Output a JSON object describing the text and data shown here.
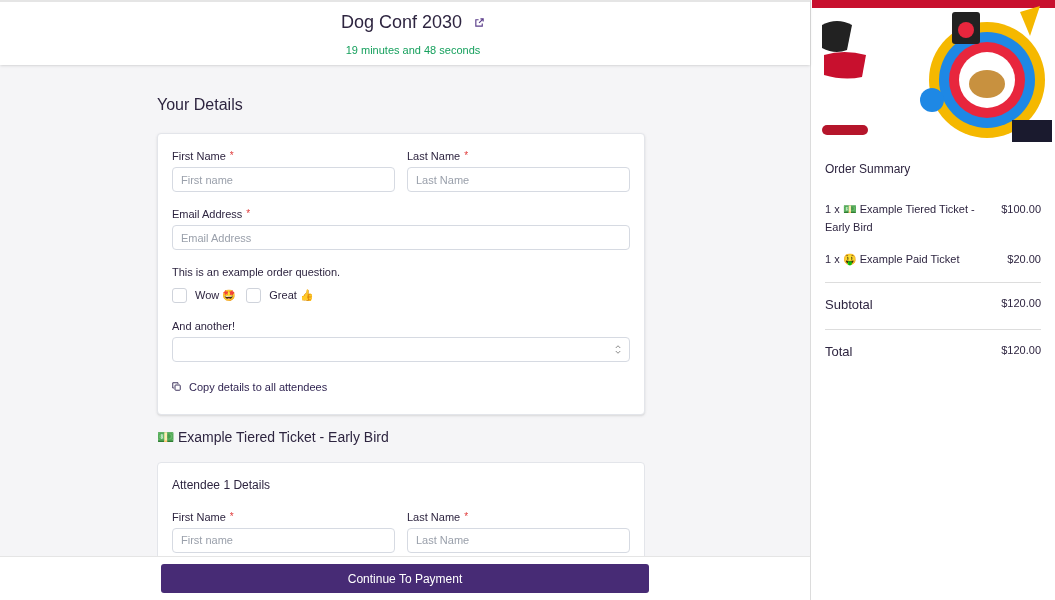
{
  "header": {
    "title": "Dog Conf 2030",
    "timer": "19 minutes and 48 seconds"
  },
  "details": {
    "heading": "Your Details",
    "name_fields": [
      {
        "label": "First Name",
        "required_mark": "*",
        "placeholder": "First name"
      },
      {
        "label": "Last Name",
        "required_mark": "*",
        "placeholder": "Last Name"
      }
    ],
    "email_field": {
      "label": "Email Address",
      "required_mark": "*",
      "placeholder": "Email Address"
    },
    "question": {
      "label": "This is an example order question.",
      "options": [
        {
          "label": "Wow 🤩",
          "checked": false
        },
        {
          "label": "Great 👍",
          "checked": false
        }
      ]
    },
    "select": {
      "label": "And another!"
    },
    "copy_link": "Copy details to all attendees"
  },
  "tickets": [
    {
      "heading": "💵 Example Tiered Ticket - Early Bird",
      "attendee": {
        "heading": "Attendee 1 Details",
        "fields": [
          {
            "label": "First Name",
            "required_mark": "*",
            "placeholder": "First name"
          },
          {
            "label": "Last Name",
            "required_mark": "*",
            "placeholder": "Last Name"
          }
        ]
      }
    }
  ],
  "continue_button": "Continue To Payment",
  "summary": {
    "heading": "Order Summary",
    "items": [
      {
        "name": "1 x 💵 Example Tiered Ticket - Early Bird",
        "price": "$100.00"
      },
      {
        "name": "1 x 🤑 Example Paid Ticket",
        "price": "$20.00"
      }
    ],
    "subtotal": {
      "label": "Subtotal",
      "value": "$120.00"
    },
    "total": {
      "label": "Total",
      "value": "$120.00"
    }
  }
}
